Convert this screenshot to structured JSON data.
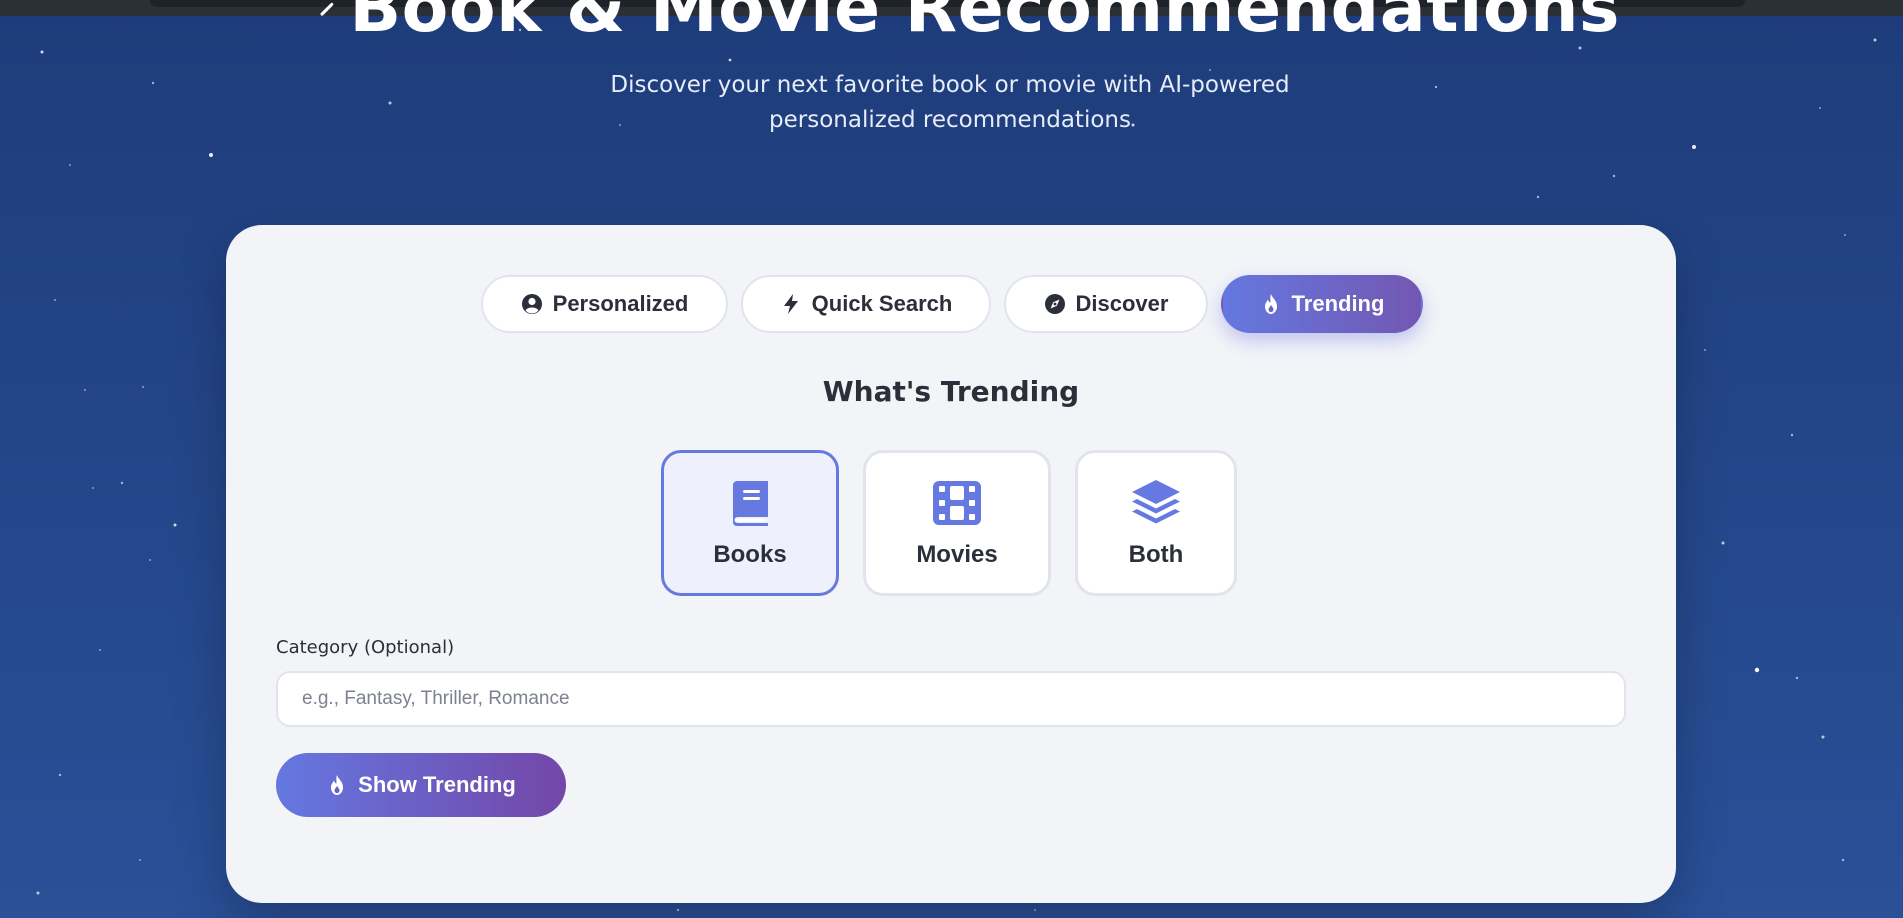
{
  "header": {
    "title": "Book & Movie Recommendations",
    "subtitle_line1": "Discover your next favorite book or movie with AI-powered",
    "subtitle_line2": "personalized recommendations"
  },
  "mode_tabs": [
    {
      "label": "Personalized",
      "icon": "user-circle-icon",
      "active": false
    },
    {
      "label": "Quick Search",
      "icon": "bolt-icon",
      "active": false
    },
    {
      "label": "Discover",
      "icon": "compass-icon",
      "active": false
    },
    {
      "label": "Trending",
      "icon": "fire-icon",
      "active": true
    }
  ],
  "trending": {
    "title": "What's Trending",
    "types": [
      {
        "label": "Books",
        "icon": "book-icon",
        "selected": true
      },
      {
        "label": "Movies",
        "icon": "film-icon",
        "selected": false
      },
      {
        "label": "Both",
        "icon": "layers-icon",
        "selected": false
      }
    ],
    "category_label": "Category (Optional)",
    "category_placeholder": "e.g., Fantasy, Thriller, Romance",
    "category_value": "",
    "submit_label": "Show Trending"
  },
  "colors": {
    "accent": "#6679e0",
    "accent_end": "#7446a8",
    "background": "#234588",
    "card": "#f3f4f8"
  }
}
